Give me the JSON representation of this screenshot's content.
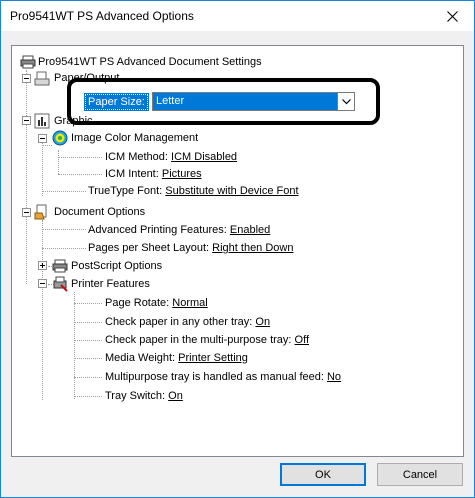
{
  "window": {
    "title": "Pro9541WT PS Advanced Options",
    "close_icon": "close-icon"
  },
  "tree": {
    "root": "Pro9541WT PS Advanced Document Settings",
    "paper_output": {
      "label": "Paper/Output",
      "paper_size_label": "Paper Size:",
      "paper_size_value": "Letter"
    },
    "graphic": {
      "label": "Graphic",
      "image_color_management": "Image Color Management",
      "icm_method_label": "ICM Method:",
      "icm_method_value": "ICM Disabled",
      "icm_intent_label": "ICM Intent:",
      "icm_intent_value": "Pictures",
      "truetype_label": "TrueType Font:",
      "truetype_value": "Substitute with Device Font"
    },
    "document_options": {
      "label": "Document Options",
      "advanced_printing_label": "Advanced Printing Features:",
      "advanced_printing_value": "Enabled",
      "pages_per_sheet_label": "Pages per Sheet Layout:",
      "pages_per_sheet_value": "Right then Down",
      "postscript_options": "PostScript Options",
      "printer_features": "Printer Features",
      "features": [
        {
          "label": "Page Rotate:",
          "value": "Normal"
        },
        {
          "label": "Check paper in any other tray:",
          "value": "On"
        },
        {
          "label": "Check paper in the multi-purpose tray:",
          "value": "Off"
        },
        {
          "label": "Media Weight:",
          "value": "Printer Setting"
        },
        {
          "label": "Multipurpose tray is handled as manual feed:",
          "value": "No"
        },
        {
          "label": "Tray Switch:",
          "value": "On"
        }
      ]
    }
  },
  "buttons": {
    "ok": "OK",
    "cancel": "Cancel"
  },
  "colors": {
    "selection": "#0078d7",
    "window_border": "#1883d7"
  }
}
